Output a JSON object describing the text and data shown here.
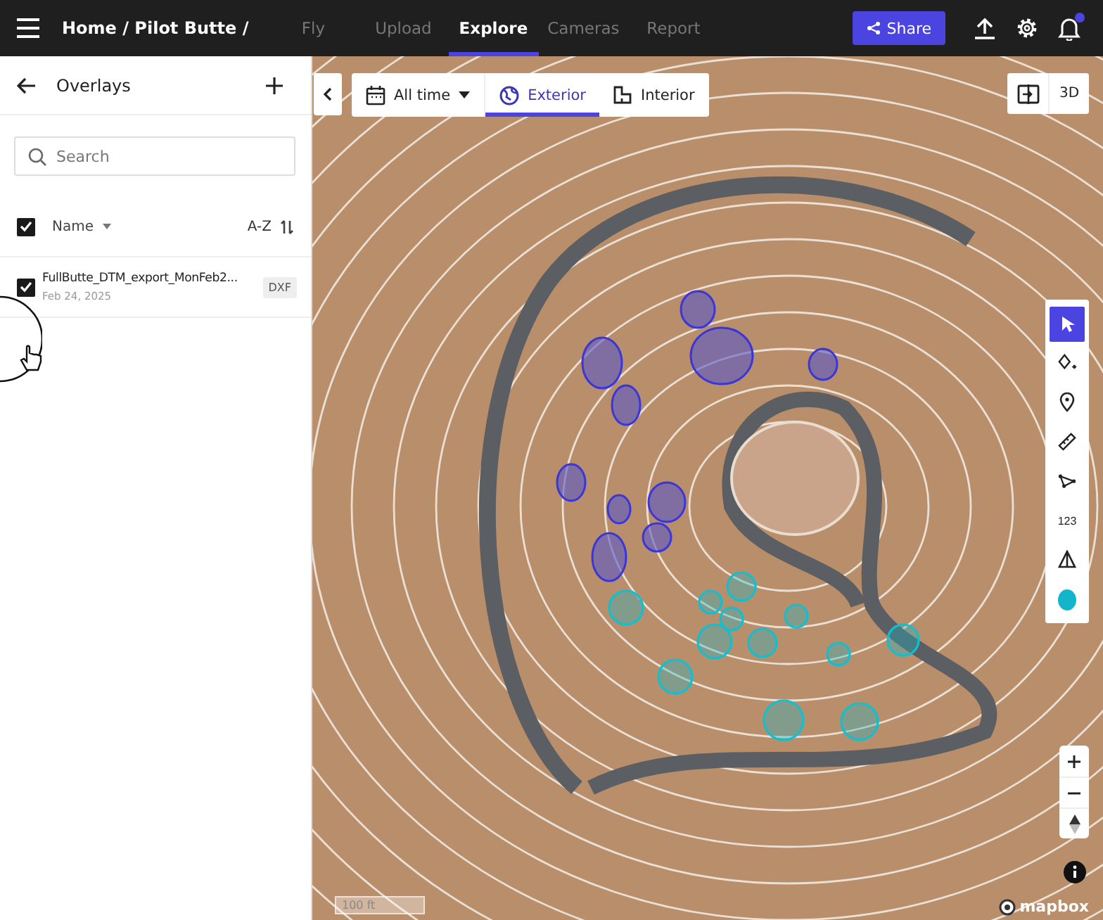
{
  "topbar": {
    "breadcrumb": "Home / Pilot Butte /",
    "nav": [
      {
        "label": "Fly",
        "selected": false
      },
      {
        "label": "Upload",
        "selected": false
      },
      {
        "label": "Explore",
        "selected": true
      },
      {
        "label": "Cameras",
        "selected": false
      },
      {
        "label": "Report",
        "selected": false
      }
    ],
    "share": "Share",
    "unread_notifications": true
  },
  "sidebar": {
    "title": "Overlays",
    "search": {
      "placeholder": "Search"
    },
    "list_header": {
      "all_checked": true,
      "column": "Name",
      "sort": "A-Z"
    },
    "items": [
      {
        "name": "FullButte_DTM_export_MonFeb2...",
        "date": "Feb 24, 2025",
        "type": "DXF",
        "checked": true
      }
    ]
  },
  "map": {
    "time_filter": "All time",
    "views": [
      {
        "label": "Exterior",
        "kind": "globe",
        "selected": true
      },
      {
        "label": "Interior",
        "kind": "floorplan",
        "selected": false
      }
    ],
    "mode_3d": "3D",
    "tools": [
      {
        "kind": "pointer",
        "selected": true
      },
      {
        "kind": "shape",
        "selected": false
      },
      {
        "kind": "pin",
        "selected": false
      },
      {
        "kind": "ruler",
        "selected": false
      },
      {
        "kind": "path",
        "selected": false
      },
      {
        "kind": "number",
        "label": "123",
        "selected": false
      },
      {
        "kind": "pyramid",
        "selected": false
      },
      {
        "kind": "color",
        "color": "#13b5cb",
        "selected": false
      }
    ],
    "scale": "100 ft",
    "attribution": "mapbox"
  }
}
